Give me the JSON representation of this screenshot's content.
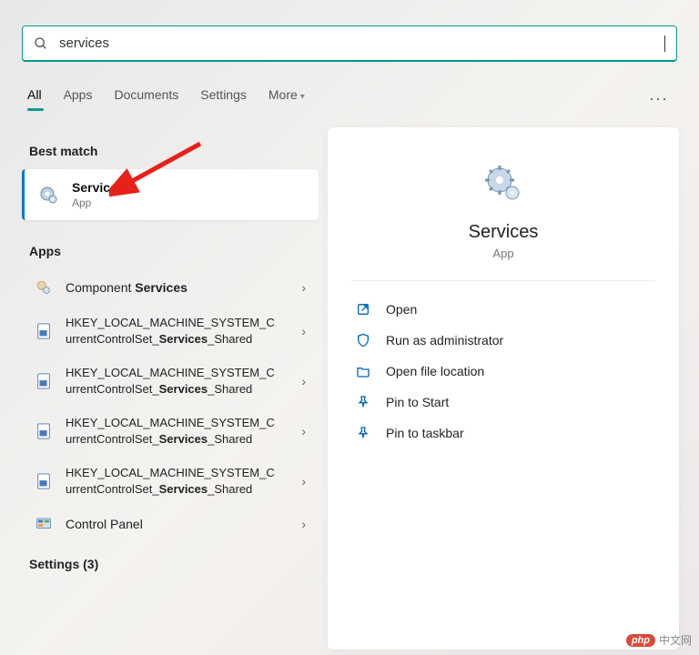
{
  "search": {
    "value": "services"
  },
  "tabs": {
    "all": "All",
    "apps": "Apps",
    "documents": "Documents",
    "settings": "Settings",
    "more": "More"
  },
  "sections": {
    "best_match": "Best match",
    "apps": "Apps",
    "settings": "Settings (3)"
  },
  "best_match": {
    "title": "Services",
    "subtitle": "App"
  },
  "results": {
    "component_services_pre": "Component ",
    "component_services_hl": "Services",
    "reg1_a": "HKEY_LOCAL_MACHINE_SYSTEM_C",
    "reg1_b_pre": "urrentControlSet_",
    "reg1_b_hl": "Services",
    "reg1_b_post": "_Shared",
    "control_panel": "Control Panel"
  },
  "detail": {
    "title": "Services",
    "type": "App",
    "actions": {
      "open": "Open",
      "run_admin": "Run as administrator",
      "open_loc": "Open file location",
      "pin_start": "Pin to Start",
      "pin_taskbar": "Pin to taskbar"
    }
  },
  "watermark": {
    "badge": "php",
    "text": "中文网"
  }
}
